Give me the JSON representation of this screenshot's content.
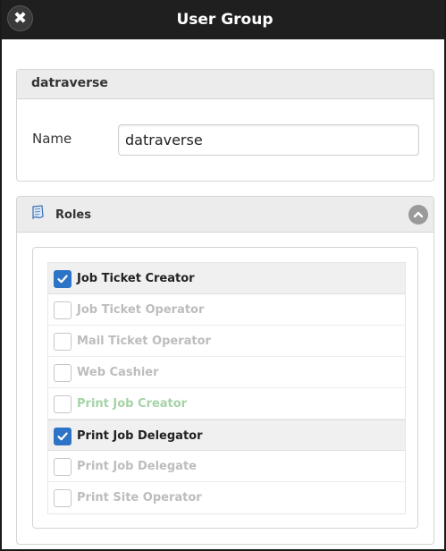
{
  "dialog": {
    "title": "User Group",
    "close_icon": "close-icon"
  },
  "group": {
    "header": "datraverse",
    "name_label": "Name",
    "name_value": "datraverse"
  },
  "roles": {
    "title": "Roles",
    "icon": "roles-document-icon",
    "collapse_icon": "chevron-up-icon",
    "items": [
      {
        "label": "Job Ticket Creator",
        "checked": true
      },
      {
        "label": "Job Ticket Operator",
        "checked": false
      },
      {
        "label": "Mail Ticket Operator",
        "checked": false
      },
      {
        "label": "Web Cashier",
        "checked": false
      },
      {
        "label": "Print Job Creator",
        "checked": false
      },
      {
        "label": "Print Job Delegator",
        "checked": true
      },
      {
        "label": "Print Job Delegate",
        "checked": false
      },
      {
        "label": "Print Site Operator",
        "checked": false
      }
    ]
  },
  "colors": {
    "titlebar": "#1f1f1f",
    "checkbox_checked": "#2d73c6",
    "disabled_text": "#bdbdbd",
    "print_job_creator_text": "#a6d3a6"
  }
}
